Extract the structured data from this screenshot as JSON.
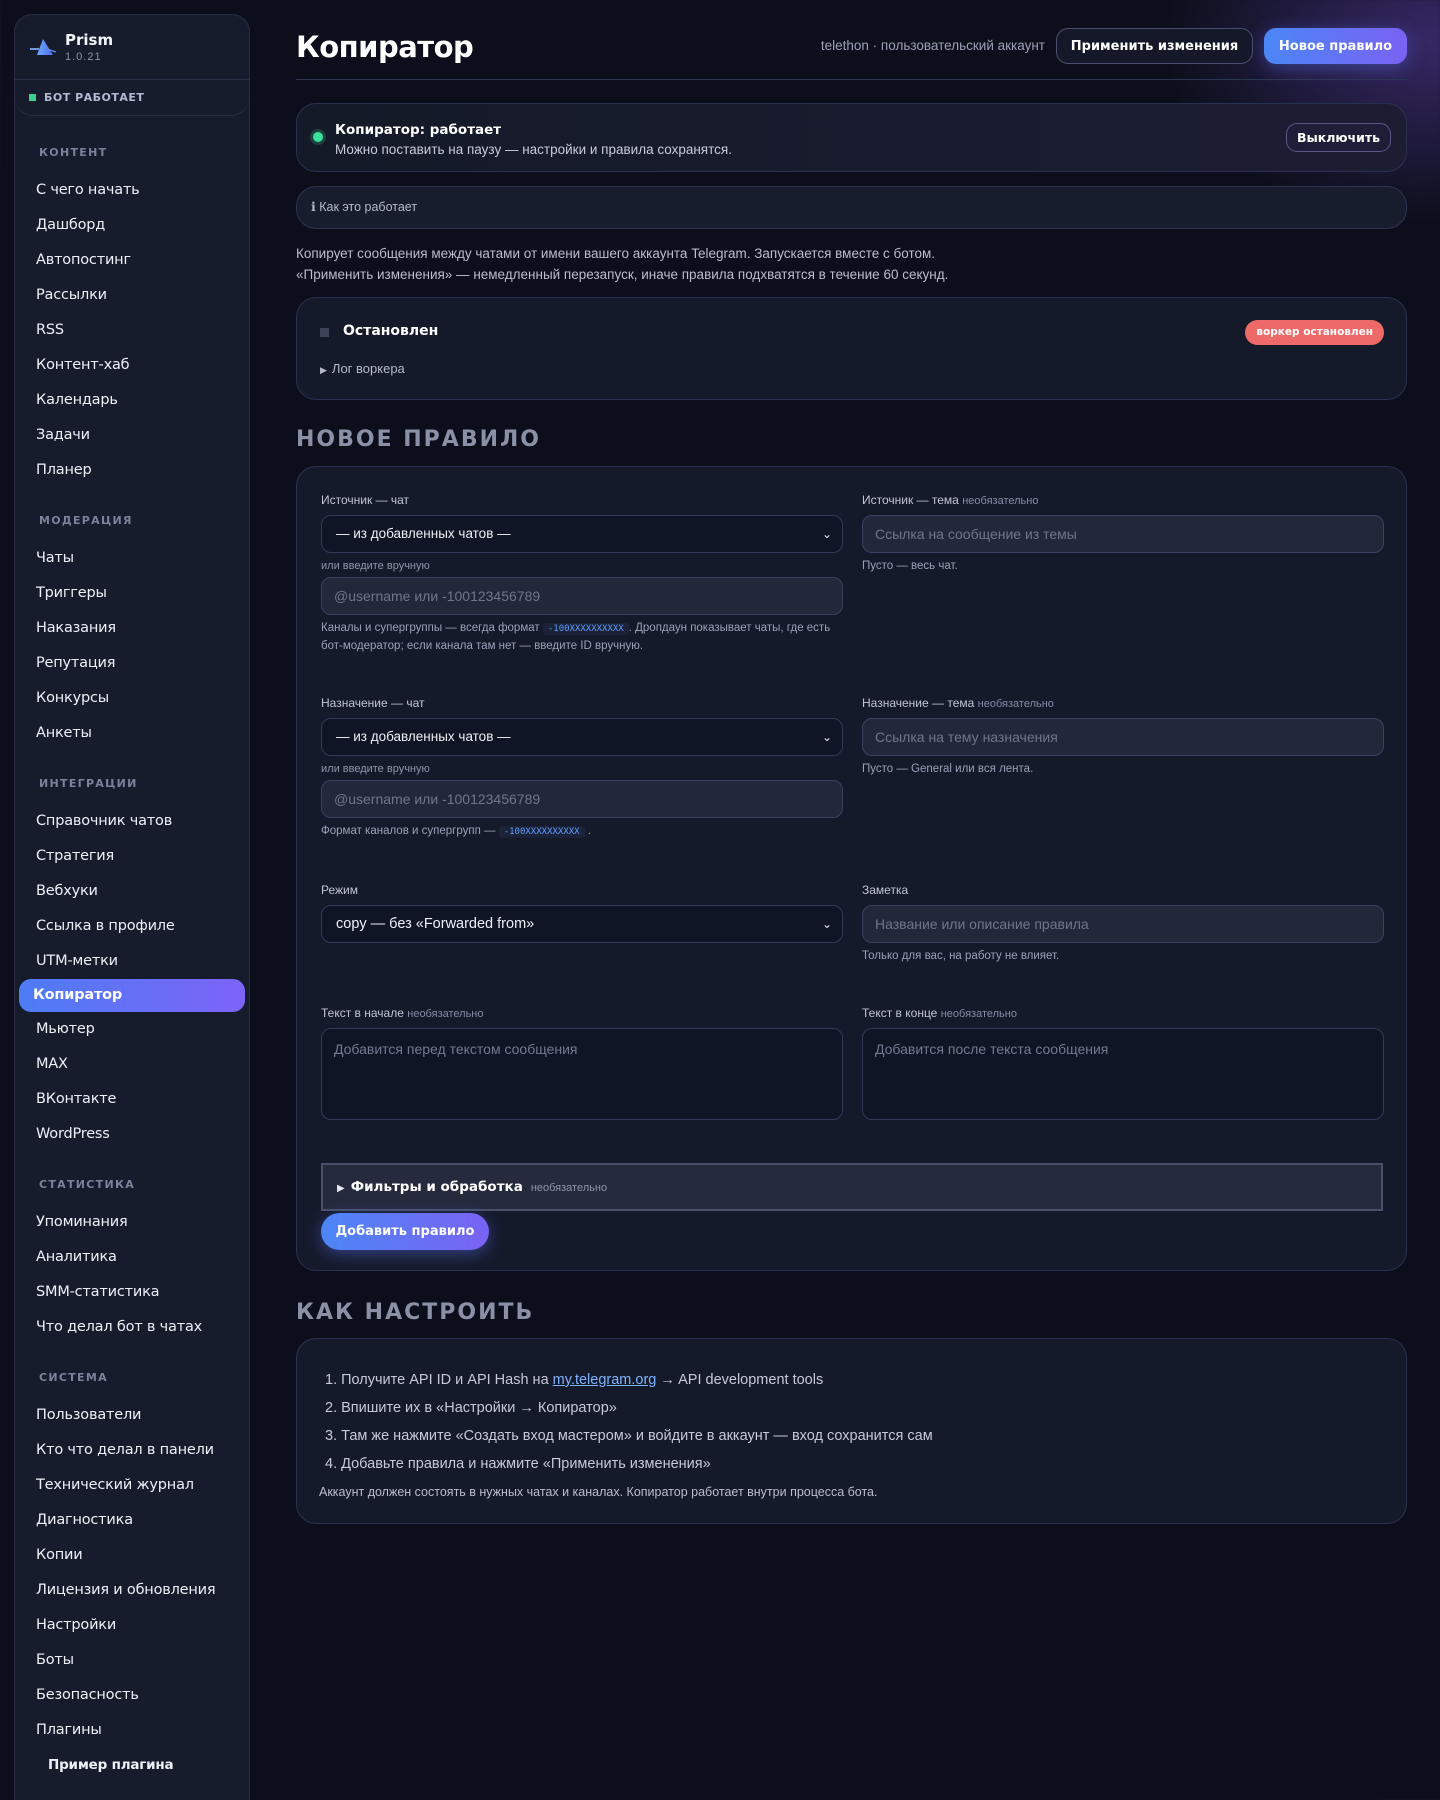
{
  "sidebar": {
    "brand": {
      "name": "Prism",
      "version": "1.0.21",
      "logo_icon": "prism-logo-icon"
    },
    "bot_status": "БОТ РАБОТАЕТ",
    "sections": [
      {
        "title": "КОНТЕНТ",
        "items": [
          "С чего начать",
          "Дашборд",
          "Автопостинг",
          "Рассылки",
          "RSS",
          "Контент-хаб",
          "Календарь",
          "Задачи",
          "Планер"
        ]
      },
      {
        "title": "МОДЕРАЦИЯ",
        "items": [
          "Чаты",
          "Триггеры",
          "Наказания",
          "Репутация",
          "Конкурсы",
          "Анкеты"
        ]
      },
      {
        "title": "ИНТЕГРАЦИИ",
        "items": [
          "Справочник чатов",
          "Стратегия",
          "Вебхуки",
          "Ссылка в профиле",
          "UTM-метки",
          "Копиратор",
          "Мьютер",
          "MAX",
          "ВКонтакте",
          "WordPress"
        ]
      },
      {
        "title": "СТАТИСТИКА",
        "items": [
          "Упоминания",
          "Аналитика",
          "SMM-статистика",
          "Что делал бот в чатах"
        ]
      },
      {
        "title": "СИСТЕМА",
        "items": [
          "Пользователи",
          "Кто что делал в панели",
          "Технический журнал",
          "Диагностика",
          "Копии",
          "Лицензия и обновления",
          "Настройки",
          "Боты",
          "Безопасность",
          "Плагины"
        ]
      }
    ],
    "sub_item": "Пример плагина",
    "active_item": "Копиратор"
  },
  "header": {
    "title": "Копиратор",
    "account": "telethon · пользовательский аккаунт",
    "apply_label": "Применить изменения",
    "new_rule_label": "Новое правило"
  },
  "status": {
    "title": "Копиратор: работает",
    "subtitle": "Можно поставить на паузу — настройки и правила сохранятся.",
    "toggle_label": "Выключить"
  },
  "how_it_works": "ℹ Как это работает",
  "description": [
    "Копирует сообщения между чатами от имени вашего аккаунта Telegram. Запускается вместе с ботом.",
    "«Применить изменения» — немедленный перезапуск, иначе правила подхватятся в течение 60 секунд."
  ],
  "worker": {
    "title": "Остановлен",
    "log_label": "Лог воркера",
    "badge": "воркер остановлен"
  },
  "new_rule": {
    "heading": "НОВОЕ ПРАВИЛО",
    "optional": "необязательно",
    "source_chat_label": "Источник — чат",
    "source_chat_select": "— из добавленных чатов —",
    "manual_label": "или введите вручную",
    "source_chat_placeholder": "@username или -100123456789",
    "source_hint_a": "Каналы и супергруппы — всегда формат",
    "code_sample": "-100XXXXXXXXXX",
    "source_hint_b": ". Дропдаун показывает чаты, где есть",
    "source_hint_c": "бот-модератор; если канала там нет — введите ID вручную.",
    "source_topic_label": "Источник — тема",
    "source_topic_placeholder": "Ссылка на сообщение из темы",
    "source_topic_hint": "Пусто — весь чат.",
    "dest_chat_label": "Назначение — чат",
    "dest_chat_select": "— из добавленных чатов —",
    "dest_chat_placeholder": "@username или -100123456789",
    "dest_hint": "Формат каналов и супергрупп —",
    "dest_hint_end": ".",
    "dest_topic_label": "Назначение — тема",
    "dest_topic_placeholder": "Ссылка на тему назначения",
    "dest_topic_hint": "Пусто — General или вся лента.",
    "mode_label": "Режим",
    "mode_select": "copy — без «Forwarded from»",
    "note_label": "Заметка",
    "note_placeholder": "Название или описание правила",
    "note_hint": "Только для вас, на работу не влияет.",
    "text_start_label": "Текст в начале",
    "text_start_placeholder": "Добавится перед текстом сообщения",
    "text_end_label": "Текст в конце",
    "text_end_placeholder": "Добавится после текста сообщения",
    "filters_title": "Фильтры и обработка",
    "add_rule_label": "Добавить правило"
  },
  "guide": {
    "heading": "КАК НАСТРОИТЬ",
    "step1_a": "1. Получите API ID и API Hash на",
    "step1_link": "my.telegram.org",
    "step1_b": "→ API development tools",
    "step2": "2. Впишите их в «Настройки → Копиратор»",
    "step3": "3. Там же нажмите «Создать вход мастером» и войдите в аккаунт — вход сохранится сам",
    "step4": "4. Добавьте правила и нажмите «Применить изменения»",
    "footer": "Аккаунт должен состоять в нужных чатах и каналах. Копиратор работает внутри процесса бота."
  },
  "colors": {
    "accent_start": "#4b86f6",
    "accent_end": "#7a62f4",
    "running": "#3be39a",
    "stopped": "#ee6a68"
  }
}
